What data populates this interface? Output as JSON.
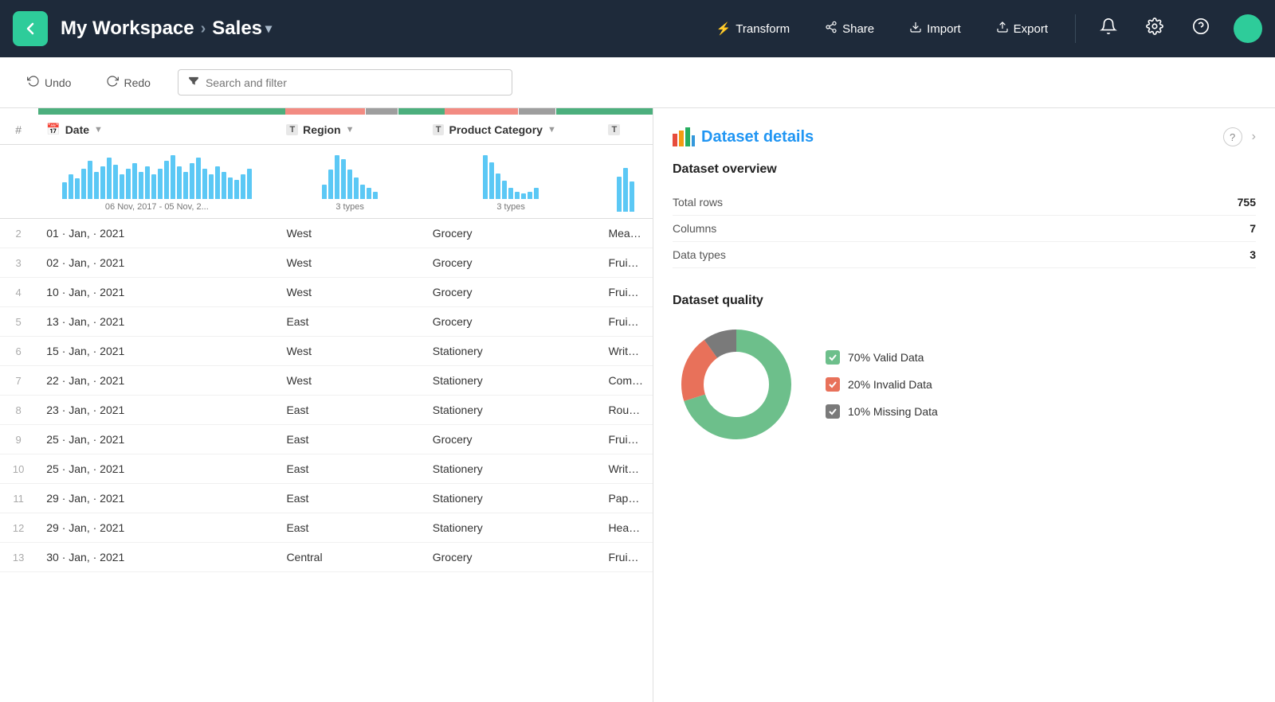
{
  "header": {
    "back_label": "←",
    "workspace": "My Workspace",
    "separator": "›",
    "dataset": "Sales",
    "dropdown_arrow": "▾",
    "actions": [
      {
        "id": "transform",
        "label": "Transform",
        "icon": "⚡"
      },
      {
        "id": "share",
        "label": "Share",
        "icon": "↗"
      },
      {
        "id": "import",
        "label": "Import",
        "icon": "↙"
      },
      {
        "id": "export",
        "label": "Export",
        "icon": "↗"
      }
    ],
    "icon_bell": "🔔",
    "icon_gear": "⚙",
    "icon_help": "?"
  },
  "toolbar": {
    "undo_label": "Undo",
    "redo_label": "Redo",
    "search_placeholder": "Search and filter"
  },
  "table": {
    "columns": [
      {
        "id": "row-num",
        "label": "#",
        "type": "none"
      },
      {
        "id": "date",
        "label": "Date",
        "type": "cal"
      },
      {
        "id": "region",
        "label": "Region",
        "type": "T"
      },
      {
        "id": "product-category",
        "label": "Product Category",
        "type": "T"
      },
      {
        "id": "col4",
        "label": "",
        "type": "T"
      }
    ],
    "date_range_label": "06 Nov, 2017 - 05 Nov, 2...",
    "region_types_label": "3 types",
    "prodcat_types_label": "3 types",
    "rows": [
      {
        "num": "2",
        "date": "01 · Jan, · 2021",
        "region": "West",
        "product_category": "Grocery",
        "col4": "Mea"
      },
      {
        "num": "3",
        "date": "02 · Jan, · 2021",
        "region": "West",
        "product_category": "Grocery",
        "col4": "Frui"
      },
      {
        "num": "4",
        "date": "10 · Jan, · 2021",
        "region": "West",
        "product_category": "Grocery",
        "col4": "Frui"
      },
      {
        "num": "5",
        "date": "13 · Jan, · 2021",
        "region": "East",
        "product_category": "Grocery",
        "col4": "Frui"
      },
      {
        "num": "6",
        "date": "15 · Jan, · 2021",
        "region": "West",
        "product_category": "Stationery",
        "col4": "Writ"
      },
      {
        "num": "7",
        "date": "22 · Jan, · 2021",
        "region": "West",
        "product_category": "Stationery",
        "col4": "Com"
      },
      {
        "num": "8",
        "date": "23 · Jan, · 2021",
        "region": "East",
        "product_category": "Stationery",
        "col4": "Roun"
      },
      {
        "num": "9",
        "date": "25 · Jan, · 2021",
        "region": "East",
        "product_category": "Grocery",
        "col4": "Frui"
      },
      {
        "num": "10",
        "date": "25 · Jan, · 2021",
        "region": "East",
        "product_category": "Stationery",
        "col4": "Writ"
      },
      {
        "num": "11",
        "date": "29 · Jan, · 2021",
        "region": "East",
        "product_category": "Stationery",
        "col4": "Pape"
      },
      {
        "num": "12",
        "date": "29 · Jan, · 2021",
        "region": "East",
        "product_category": "Stationery",
        "col4": "Hea"
      },
      {
        "num": "13",
        "date": "30 · Jan, · 2021",
        "region": "Central",
        "product_category": "Grocery",
        "col4": "Frui"
      }
    ]
  },
  "panel": {
    "title": "Dataset details",
    "title_icon": "chart",
    "help_icon": "?",
    "expand_icon": ">",
    "overview": {
      "title": "Dataset overview",
      "rows": [
        {
          "label": "Total rows",
          "value": "755"
        },
        {
          "label": "Columns",
          "value": "7"
        },
        {
          "label": "Data types",
          "value": "3"
        }
      ]
    },
    "quality": {
      "title": "Dataset quality",
      "legend": [
        {
          "id": "valid",
          "label": "70% Valid Data",
          "color": "#6dbf8b",
          "check": "✓"
        },
        {
          "id": "invalid",
          "label": "20% Invalid Data",
          "color": "#e8715a",
          "check": "✓"
        },
        {
          "id": "missing",
          "label": "10% Missing Data",
          "color": "#7a7a7a",
          "check": "✓"
        }
      ],
      "donut": {
        "valid_pct": 70,
        "invalid_pct": 20,
        "missing_pct": 10
      }
    }
  },
  "histogram_date_bars": [
    12,
    18,
    15,
    22,
    28,
    20,
    24,
    30,
    25,
    18,
    22,
    26,
    20,
    24,
    18,
    22,
    28,
    32,
    24,
    20,
    26,
    30,
    22,
    18,
    24,
    20,
    16,
    14,
    18,
    22
  ],
  "histogram_region_bars": [
    20,
    40,
    60,
    55,
    40,
    30,
    20,
    15,
    10
  ],
  "histogram_prodcat_bars": [
    60,
    50,
    35,
    25,
    15,
    10,
    8,
    10,
    15
  ],
  "histogram_last_bars": [
    40,
    50,
    35
  ]
}
